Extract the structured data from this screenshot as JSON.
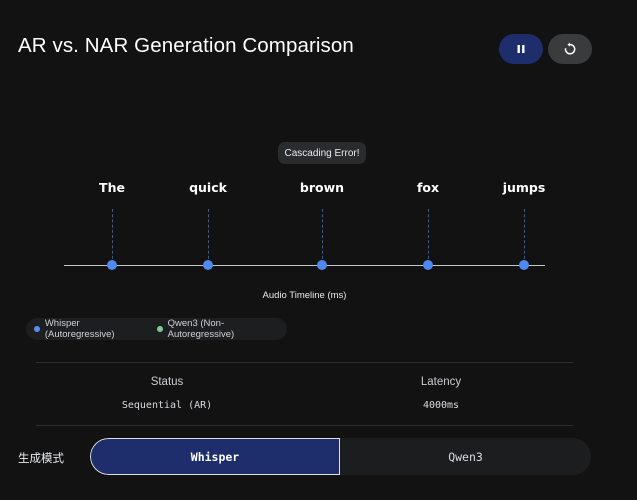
{
  "header": {
    "title": "AR vs. NAR Generation Comparison",
    "pause_icon": "pause-icon",
    "replay_icon": "replay-icon"
  },
  "timeline": {
    "tooltip": "Cascading Error!",
    "words": [
      "The",
      "quick",
      "brown",
      "fox",
      "jumps"
    ],
    "axis_label": "Audio Timeline (ms)",
    "dot_color": "#4f88ee"
  },
  "legend": {
    "items": [
      {
        "label": "Whisper (Autoregressive)",
        "color": "#5b8def"
      },
      {
        "label": "Qwen3 (Non-Autoregressive)",
        "color": "#81c995"
      }
    ]
  },
  "stats": {
    "headers": [
      "Status",
      "Latency"
    ],
    "values": [
      "Sequential (AR)",
      "4000ms"
    ]
  },
  "mode": {
    "label": "生成模式",
    "options": [
      "Whisper",
      "Qwen3"
    ],
    "selected": "Whisper",
    "accent": "#1e2d6b"
  }
}
